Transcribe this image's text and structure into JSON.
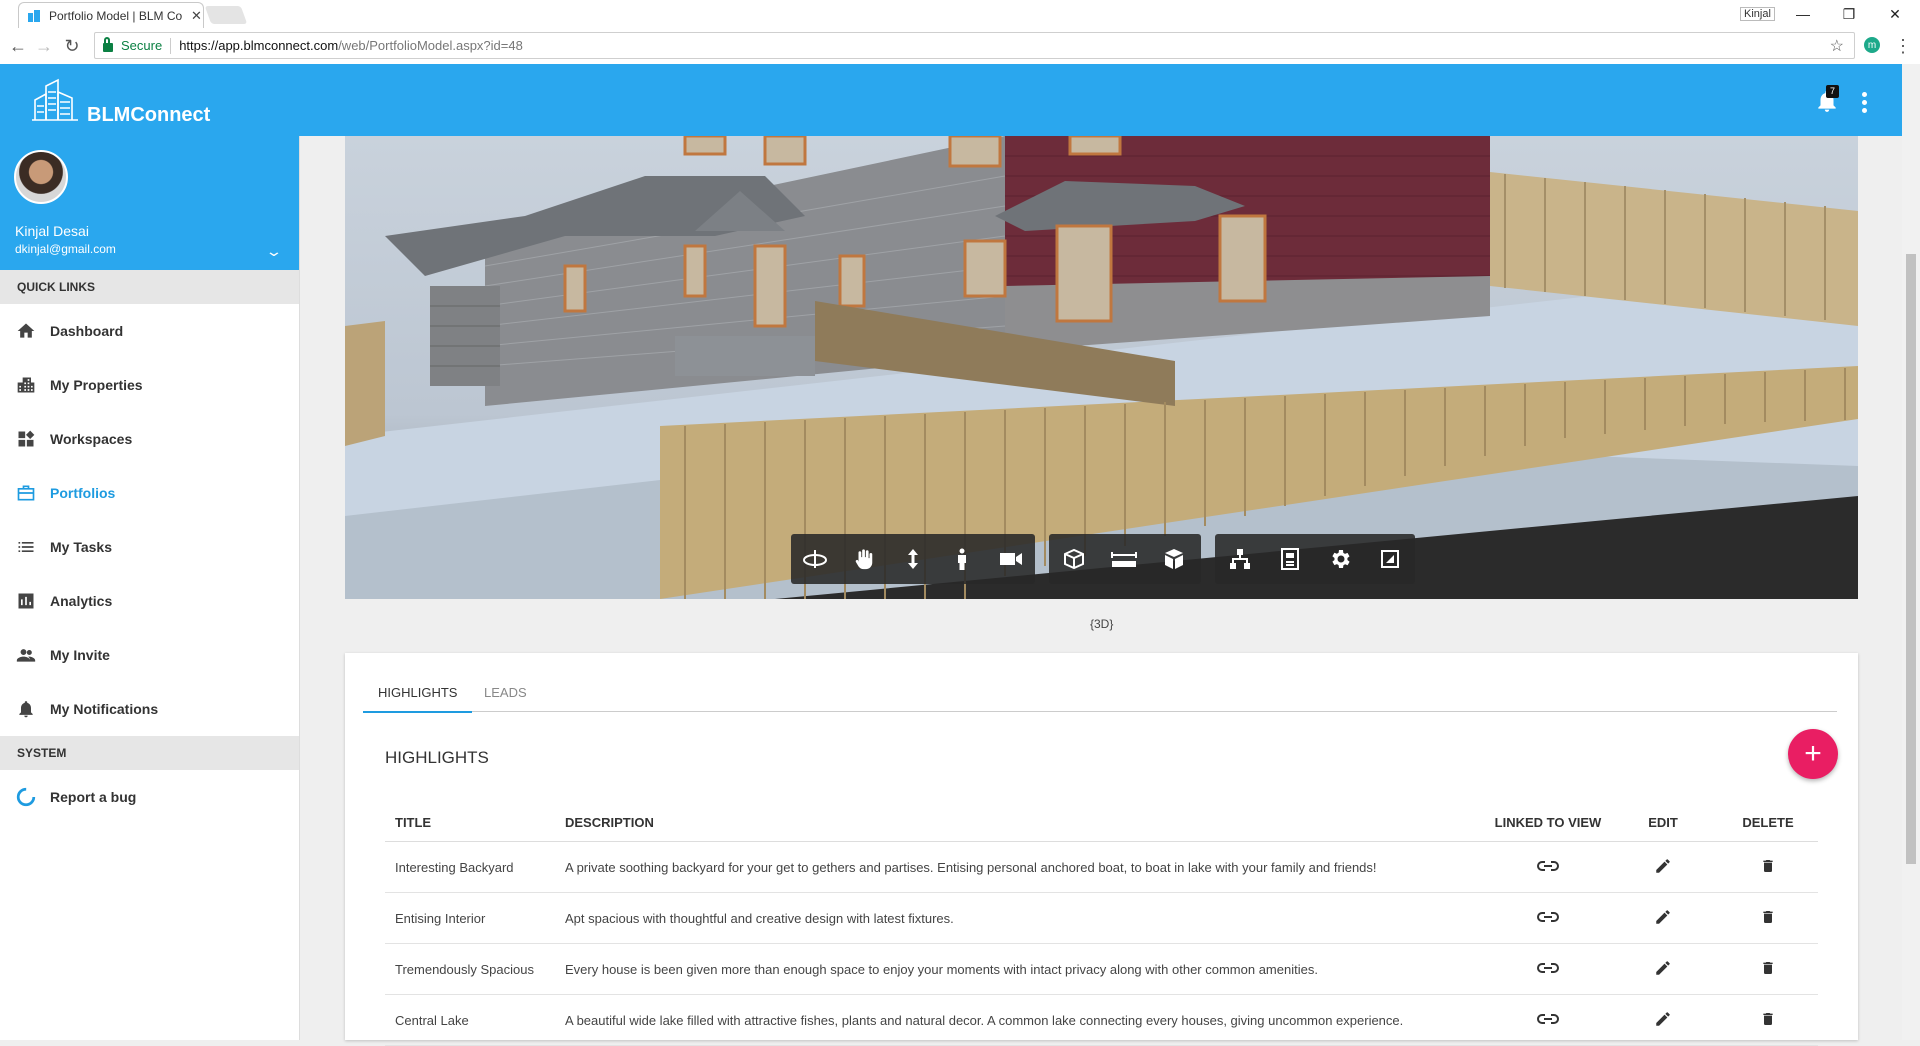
{
  "browser": {
    "tab_title": "Portfolio Model | BLM Co",
    "tab_close": "✕",
    "window_user": "Kinjal",
    "secure_label": "Secure",
    "url_host": "https://app.blmconnect.com",
    "url_path": "/web/PortfolioModel.aspx?id=48",
    "extension_letter": "m"
  },
  "header": {
    "brand": "BLMConnect",
    "notification_count": "7",
    "brand_color": "#2aa7ee"
  },
  "sidebar": {
    "user_name": "Kinjal Desai",
    "user_email": "dkinjal@gmail.com",
    "quick_links_label": "QUICK LINKS",
    "system_label": "SYSTEM",
    "items": [
      {
        "label": "Dashboard",
        "icon": "home-icon"
      },
      {
        "label": "My Properties",
        "icon": "buildings-icon"
      },
      {
        "label": "Workspaces",
        "icon": "widgets-icon"
      },
      {
        "label": "Portfolios",
        "icon": "briefcase-icon",
        "active": true
      },
      {
        "label": "My Tasks",
        "icon": "list-icon"
      },
      {
        "label": "Analytics",
        "icon": "bar-chart-icon"
      },
      {
        "label": "My Invite",
        "icon": "people-icon"
      },
      {
        "label": "My Notifications",
        "icon": "bell-icon"
      }
    ],
    "system_items": [
      {
        "label": "Report a bug",
        "icon": "spinner-icon"
      }
    ],
    "active_color": "#1e9be0"
  },
  "viewer": {
    "caption": "{3D}",
    "tools": [
      "orbit-icon",
      "pan-hand-icon",
      "zoom-icon",
      "walk-person-icon",
      "camera-icon",
      "section-box-icon",
      "measure-icon",
      "cube-view-icon",
      "model-tree-icon",
      "properties-icon",
      "settings-gear-icon",
      "fullscreen-icon"
    ]
  },
  "card": {
    "tabs": [
      "HIGHLIGHTS",
      "LEADS"
    ],
    "section_title": "HIGHLIGHTS",
    "add_label": "+",
    "accent": "#e91e63",
    "columns": [
      "TITLE",
      "DESCRIPTION",
      "LINKED TO VIEW",
      "EDIT",
      "DELETE"
    ],
    "rows": [
      {
        "title": "Interesting Backyard",
        "description": "A private soothing backyard for your get to gethers and partises. Entising personal anchored boat, to boat in lake with your family and friends!"
      },
      {
        "title": "Entising Interior",
        "description": "Apt spacious with thoughtful and creative design with latest fixtures."
      },
      {
        "title": "Tremendously Spacious",
        "description": "Every house is been given more than enough space to enjoy your moments with intact privacy along with other common amenities."
      },
      {
        "title": "Central Lake",
        "description": "A beautiful wide lake filled with attractive fishes, plants and natural decor. A common lake connecting every houses, giving uncommon experience."
      }
    ]
  }
}
